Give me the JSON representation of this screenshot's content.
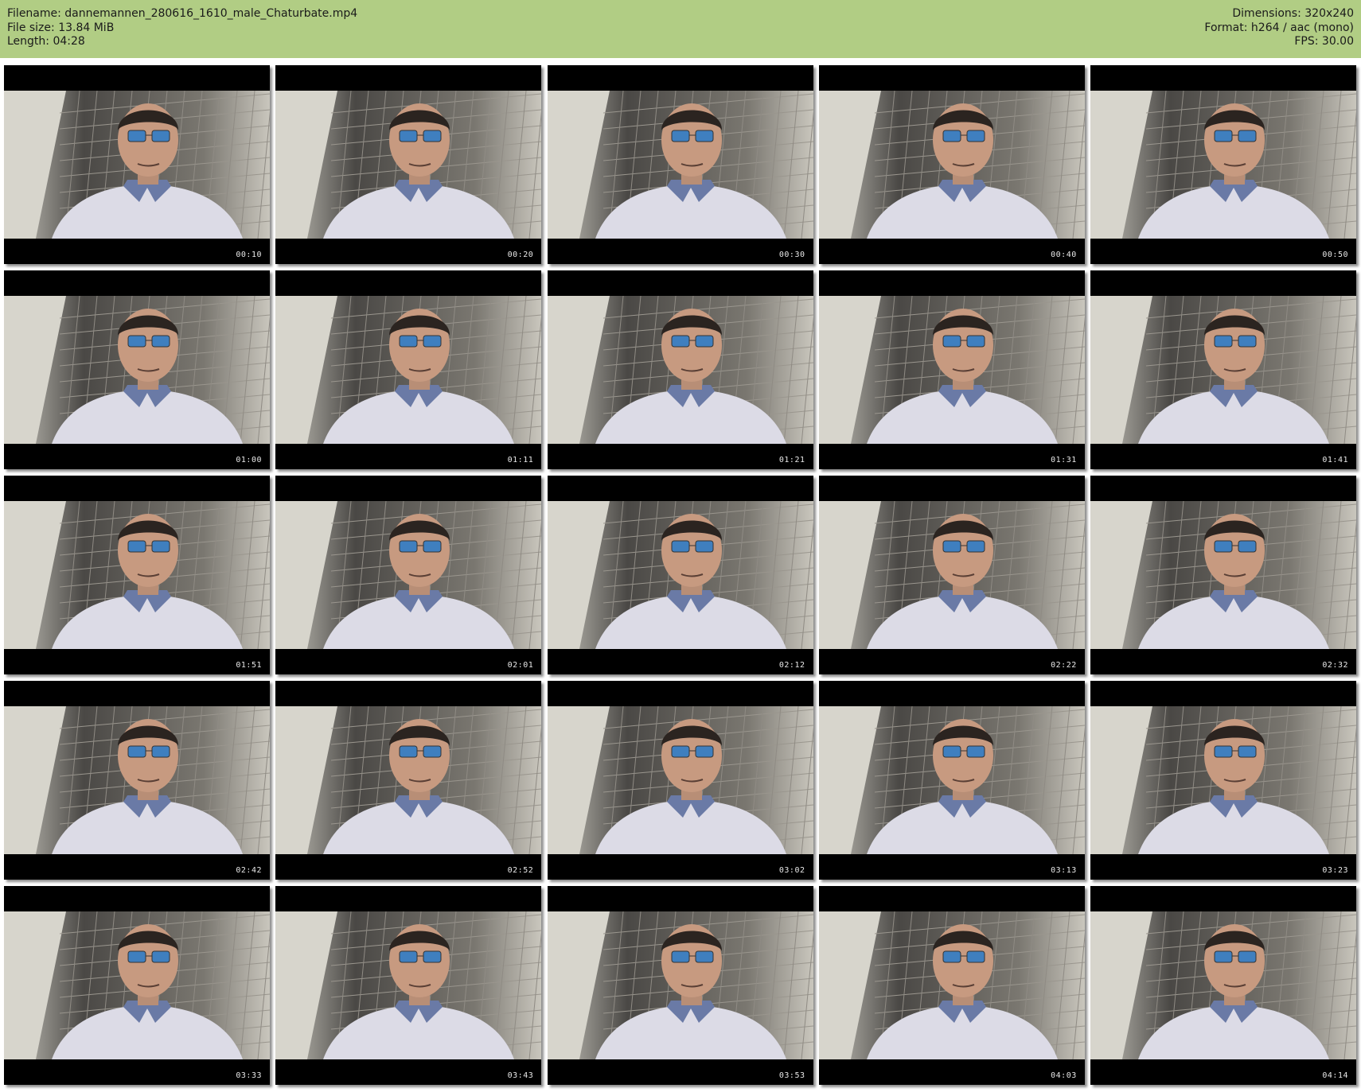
{
  "header": {
    "filename": "Filename: dannemannen_280616_1610_male_Chaturbate.mp4",
    "filesize": "File size: 13.84 MiB",
    "length": "Length: 04:28",
    "dimensions": "Dimensions: 320x240",
    "format": "Format: h264 / aac (mono)",
    "fps": "FPS: 30.00"
  },
  "thumbnails": [
    {
      "timestamp": "00:10"
    },
    {
      "timestamp": "00:20"
    },
    {
      "timestamp": "00:30"
    },
    {
      "timestamp": "00:40"
    },
    {
      "timestamp": "00:50"
    },
    {
      "timestamp": "01:00"
    },
    {
      "timestamp": "01:11"
    },
    {
      "timestamp": "01:21"
    },
    {
      "timestamp": "01:31"
    },
    {
      "timestamp": "01:41"
    },
    {
      "timestamp": "01:51"
    },
    {
      "timestamp": "02:01"
    },
    {
      "timestamp": "02:12"
    },
    {
      "timestamp": "02:22"
    },
    {
      "timestamp": "02:32"
    },
    {
      "timestamp": "02:42"
    },
    {
      "timestamp": "02:52"
    },
    {
      "timestamp": "03:02"
    },
    {
      "timestamp": "03:13"
    },
    {
      "timestamp": "03:23"
    },
    {
      "timestamp": "03:33"
    },
    {
      "timestamp": "03:43"
    },
    {
      "timestamp": "03:53"
    },
    {
      "timestamp": "04:03"
    },
    {
      "timestamp": "04:14"
    }
  ],
  "colors": {
    "header_bg": "#b1cd84",
    "thumb_bg": "#000000",
    "timestamp": "#e8e8e8"
  }
}
